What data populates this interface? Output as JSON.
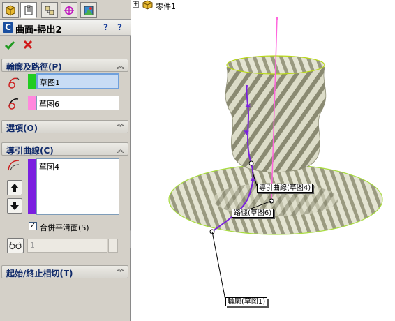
{
  "feature": {
    "title": "曲面-掃出2",
    "help_label": "?",
    "help2_label": "?"
  },
  "sections": {
    "profile_path": {
      "label": "輪廓及路徑(P)",
      "profile_value": "草图1",
      "path_value": "草图6"
    },
    "options": {
      "label": "選項(O)"
    },
    "guide_curves": {
      "label": "導引曲線(C)",
      "items": [
        "草图4"
      ],
      "merge_label": "合併平滑面(S)",
      "merge_checked": true,
      "number_value": "1"
    },
    "tangency": {
      "label": "起始/終止相切(T)"
    }
  },
  "tree": {
    "part_label": "零件1",
    "expander": "+"
  },
  "callouts": {
    "guide": "導引曲線(草图4)",
    "path": "路徑(草图6)",
    "profile": "輪廓(草图1)"
  },
  "colors": {
    "profile_swatch": "#22cc22",
    "path_swatch": "#ff88dd",
    "guide_swatch": "#7a1fe0",
    "path_line": "#ff66dd",
    "guide_line": "#7a1fe0",
    "surface_edge": "#b8e050"
  },
  "icons": {
    "feature": "sweep-surface-icon",
    "ok": "check-icon",
    "cancel": "close-icon",
    "up": "arrow-up-icon",
    "down": "arrow-down-icon"
  }
}
